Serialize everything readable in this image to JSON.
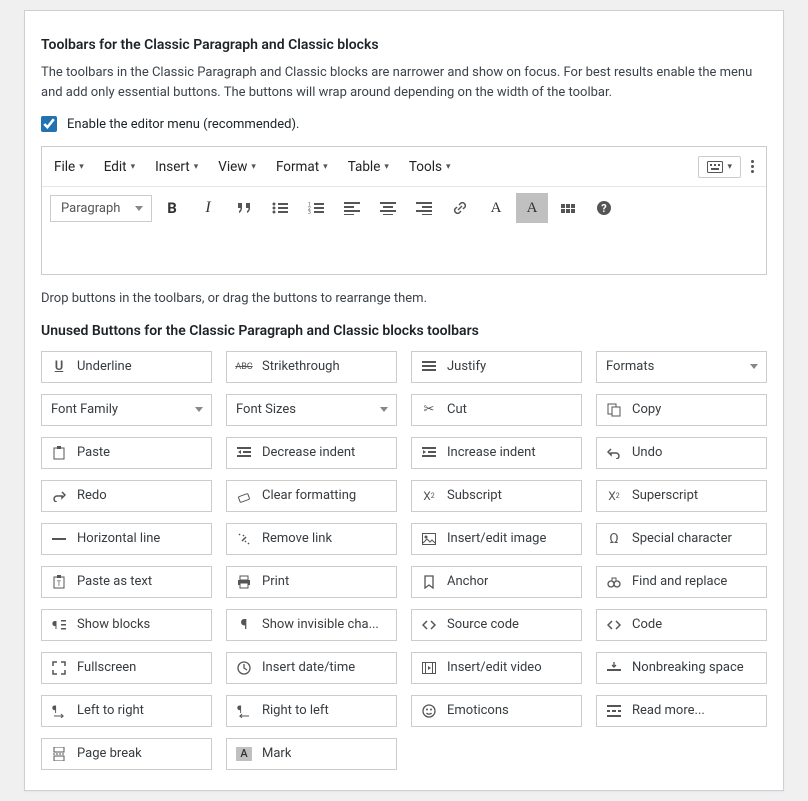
{
  "section": {
    "title": "Toolbars for the Classic Paragraph and Classic blocks",
    "description": "The toolbars in the Classic Paragraph and Classic blocks are narrower and show on focus. For best results enable the menu and add only essential buttons. The buttons will wrap around depending on the width of the toolbar.",
    "checkbox_label": "Enable the editor menu (recommended).",
    "drop_hint": "Drop buttons in the toolbars, or drag the buttons to rearrange them.",
    "unused_title": "Unused Buttons for the Classic Paragraph and Classic blocks toolbars"
  },
  "menubar": {
    "file": "File",
    "edit": "Edit",
    "insert": "Insert",
    "view": "View",
    "format": "Format",
    "table": "Table",
    "tools": "Tools"
  },
  "toolbar": {
    "paragraph": "Paragraph"
  },
  "unused": {
    "underline": "Underline",
    "strikethrough": "Strikethrough",
    "justify": "Justify",
    "formats": "Formats",
    "font_family": "Font Family",
    "font_sizes": "Font Sizes",
    "cut": "Cut",
    "copy": "Copy",
    "paste": "Paste",
    "decrease_indent": "Decrease indent",
    "increase_indent": "Increase indent",
    "undo": "Undo",
    "redo": "Redo",
    "clear_formatting": "Clear formatting",
    "subscript": "Subscript",
    "superscript": "Superscript",
    "horizontal_line": "Horizontal line",
    "remove_link": "Remove link",
    "insert_edit_image": "Insert/edit image",
    "special_character": "Special character",
    "paste_as_text": "Paste as text",
    "print": "Print",
    "anchor": "Anchor",
    "find_and_replace": "Find and replace",
    "show_blocks": "Show blocks",
    "show_invisible": "Show invisible cha...",
    "source_code": "Source code",
    "code": "Code",
    "fullscreen": "Fullscreen",
    "insert_date_time": "Insert date/time",
    "insert_edit_video": "Insert/edit video",
    "nonbreaking_space": "Nonbreaking space",
    "ltr": "Left to right",
    "rtl": "Right to left",
    "emoticons": "Emoticons",
    "read_more": "Read more...",
    "page_break": "Page break",
    "mark": "Mark"
  }
}
